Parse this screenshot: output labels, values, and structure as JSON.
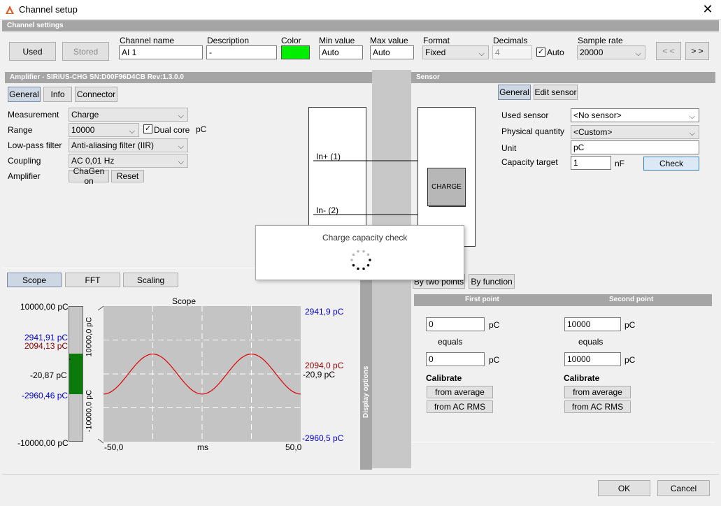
{
  "window": {
    "title": "Channel setup",
    "close": "✕"
  },
  "channel_settings": {
    "header": "Channel settings",
    "used_label": "Used",
    "stored_label": "Stored",
    "columns": {
      "name": "Channel name",
      "description": "Description",
      "color": "Color",
      "min": "Min value",
      "max": "Max value",
      "format": "Format",
      "decimals": "Decimals",
      "sample_rate": "Sample rate"
    },
    "name_value": "AI 1",
    "description_value": "-",
    "color_value": "#00ee00",
    "min_value": "Auto",
    "max_value": "Auto",
    "format_value": "Fixed",
    "decimals_value": "4",
    "auto_label": "Auto",
    "sample_rate_value": "20000",
    "prev_label": "< <",
    "next_label": "> >"
  },
  "amplifier": {
    "header": "Amplifier - SIRIUS-CHG  SN:D00F96D4CB Rev:1.3.0.0",
    "tabs": [
      "General",
      "Info",
      "Connector"
    ],
    "measurement_label": "Measurement",
    "measurement_value": "Charge",
    "range_label": "Range",
    "range_value": "10000",
    "dual_core_label": "Dual core",
    "range_unit": "pC",
    "lowpass_label": "Low-pass filter",
    "lowpass_value": "Anti-aliasing filter (IIR)",
    "coupling_label": "Coupling",
    "coupling_value": "AC  0,01 Hz",
    "amplifier_label": "Amplifier",
    "chagen_label": "ChaGen on",
    "reset_label": "Reset",
    "in_plus": "In+ (1)",
    "in_minus": "In- (2)"
  },
  "sensor": {
    "header": "Sensor",
    "tabs": [
      "General",
      "Edit sensor"
    ],
    "used_sensor_label": "Used sensor",
    "used_sensor_value": "<No sensor>",
    "physical_label": "Physical quantity",
    "physical_value": "<Custom>",
    "unit_label": "Unit",
    "unit_value": "pC",
    "capacity_label": "Capacity target",
    "capacity_value": "1",
    "capacity_unit": "nF",
    "check_label": "Check",
    "block_label": "CHARGE"
  },
  "popup": {
    "title": "Charge capacity check"
  },
  "display": {
    "tabs": [
      "Scope",
      "FFT",
      "Scaling"
    ],
    "side_label": "Display options",
    "scope_title": "Scope",
    "left_top": "10000,00 pC",
    "left_max": "2941,91 pC",
    "left_avg": "2094,13 pC",
    "left_mid": "-20,87 pC",
    "left_min": "-2960,46 pC",
    "left_bottom": "-10000,00 pC",
    "bar_top": "10000,0 pC",
    "bar_bottom": "-10000,0 pC",
    "right_max": "2941,9 pC",
    "right_avg": "2094,0 pC",
    "right_mid": "-20,9 pC",
    "right_min": "-2960,5 pC",
    "x_min": "-50,0",
    "x_unit": "ms",
    "x_max": "50,0",
    "bar_level": -0.0021
  },
  "scaling": {
    "tabs": [
      "By two points",
      "By function"
    ],
    "first_point": "First point",
    "second_point": "Second point",
    "p1_in": "0",
    "p1_out": "0",
    "p2_in": "10000",
    "p2_out": "10000",
    "unit": "pC",
    "equals": "equals",
    "calibrate": "Calibrate",
    "from_average": "from average",
    "from_ac_rms": "from AC RMS"
  },
  "footer": {
    "ok": "OK",
    "cancel": "Cancel"
  },
  "chart_data": {
    "type": "line",
    "title": "Scope",
    "xlabel": "ms",
    "xlim": [
      -50,
      50
    ],
    "ylim": [
      -10000,
      10000
    ],
    "series": [
      {
        "color": "#dd0000",
        "amplitude": 2950,
        "offset": -20,
        "period_ms": 50,
        "x": [
          -50,
          -45,
          -37.5,
          -25,
          -12.5,
          0,
          12.5,
          25,
          37.5,
          45,
          50
        ],
        "y": [
          -2960,
          -1700,
          1000,
          2942,
          1000,
          -2960,
          1000,
          2942,
          1000,
          -1700,
          -2960
        ]
      }
    ]
  }
}
